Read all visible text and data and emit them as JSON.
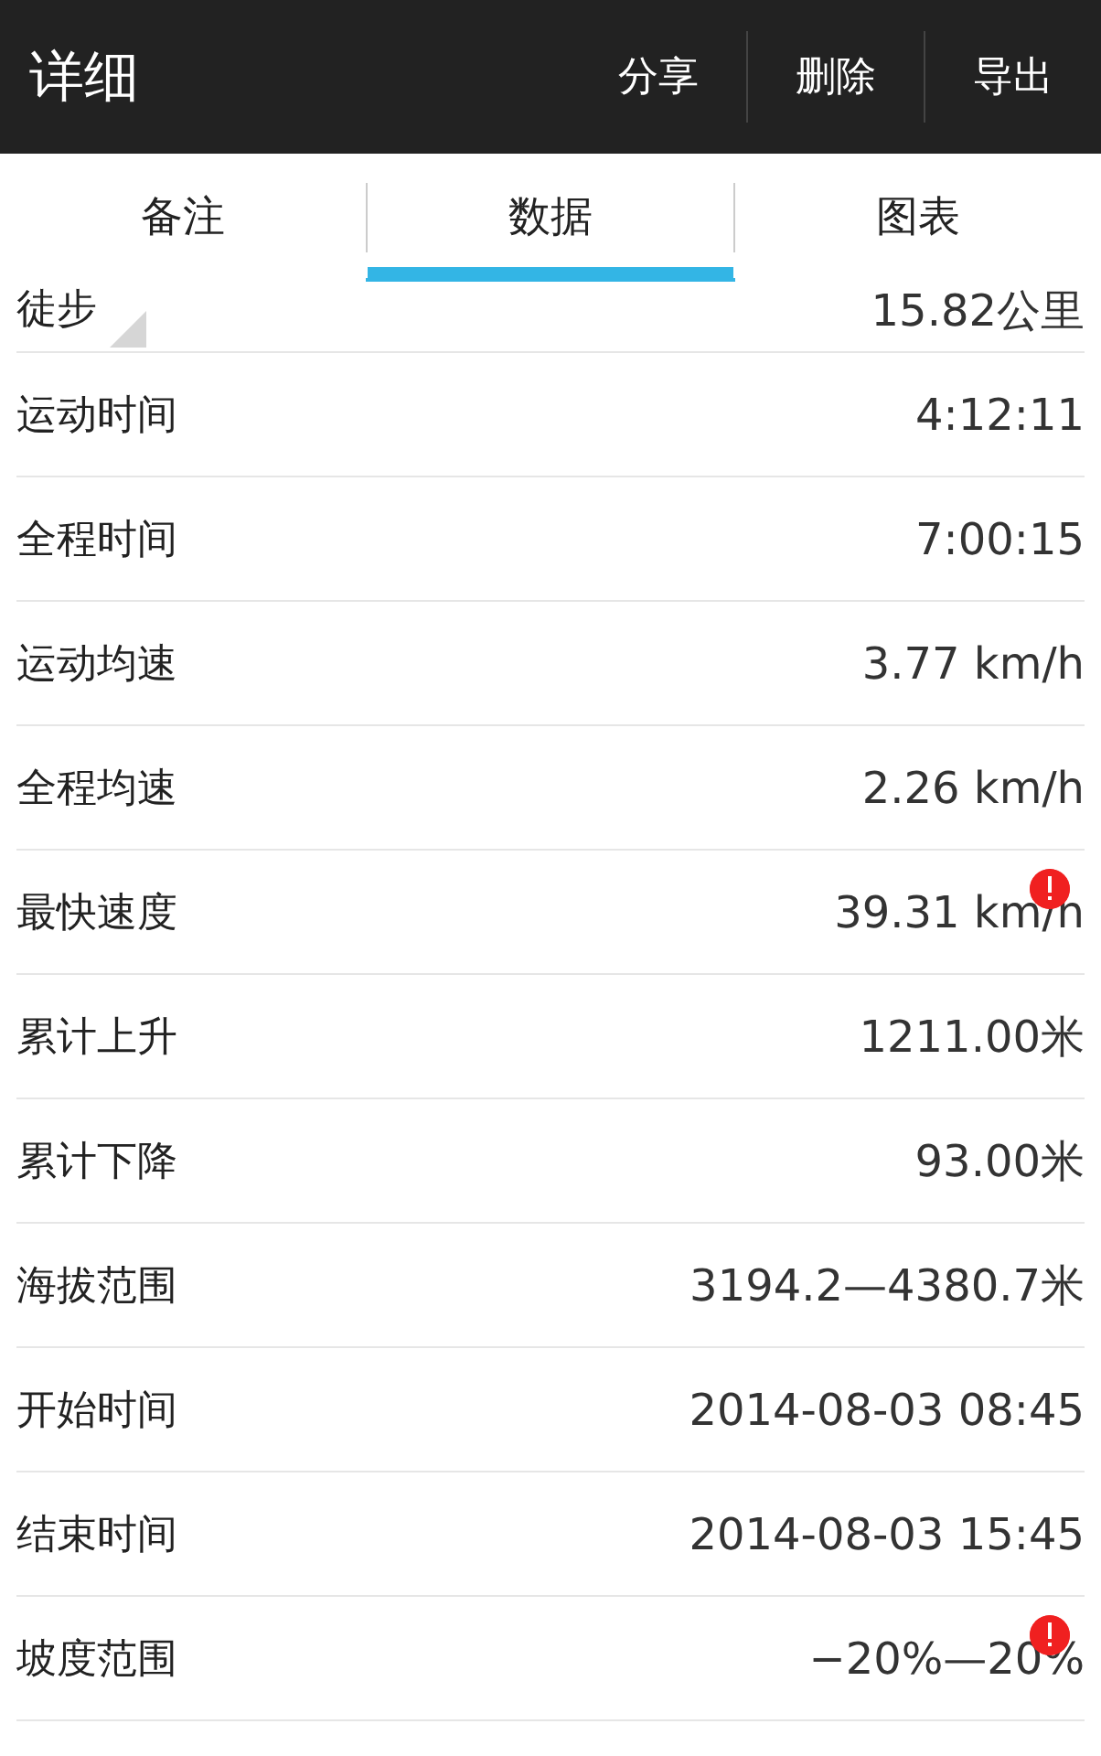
{
  "header": {
    "title": "详细",
    "actions": [
      "分享",
      "删除",
      "导出"
    ]
  },
  "tabs": [
    {
      "label": "备注",
      "selected": false
    },
    {
      "label": "数据",
      "selected": true
    },
    {
      "label": "图表",
      "selected": false
    }
  ],
  "rows": [
    {
      "label": "徒步",
      "value": "15.82公里",
      "alert": false,
      "corner_mark": true
    },
    {
      "label": "运动时间",
      "value": "4:12:11",
      "alert": false,
      "corner_mark": false
    },
    {
      "label": "全程时间",
      "value": "7:00:15",
      "alert": false,
      "corner_mark": false
    },
    {
      "label": "运动均速",
      "value": "3.77 km/h",
      "alert": false,
      "corner_mark": false
    },
    {
      "label": "全程均速",
      "value": "2.26 km/h",
      "alert": false,
      "corner_mark": false
    },
    {
      "label": "最快速度",
      "value": "39.31 km/h",
      "alert": true,
      "corner_mark": false
    },
    {
      "label": "累计上升",
      "value": "1211.00米",
      "alert": false,
      "corner_mark": false
    },
    {
      "label": "累计下降",
      "value": "93.00米",
      "alert": false,
      "corner_mark": false
    },
    {
      "label": "海拔范围",
      "value": "3194.2—4380.7米",
      "alert": false,
      "corner_mark": false
    },
    {
      "label": "开始时间",
      "value": "2014-08-03 08:45",
      "alert": false,
      "corner_mark": false
    },
    {
      "label": "结束时间",
      "value": "2014-08-03 15:45",
      "alert": false,
      "corner_mark": false
    },
    {
      "label": "坡度范围",
      "value": "−20%—20%",
      "alert": true,
      "corner_mark": false
    }
  ]
}
